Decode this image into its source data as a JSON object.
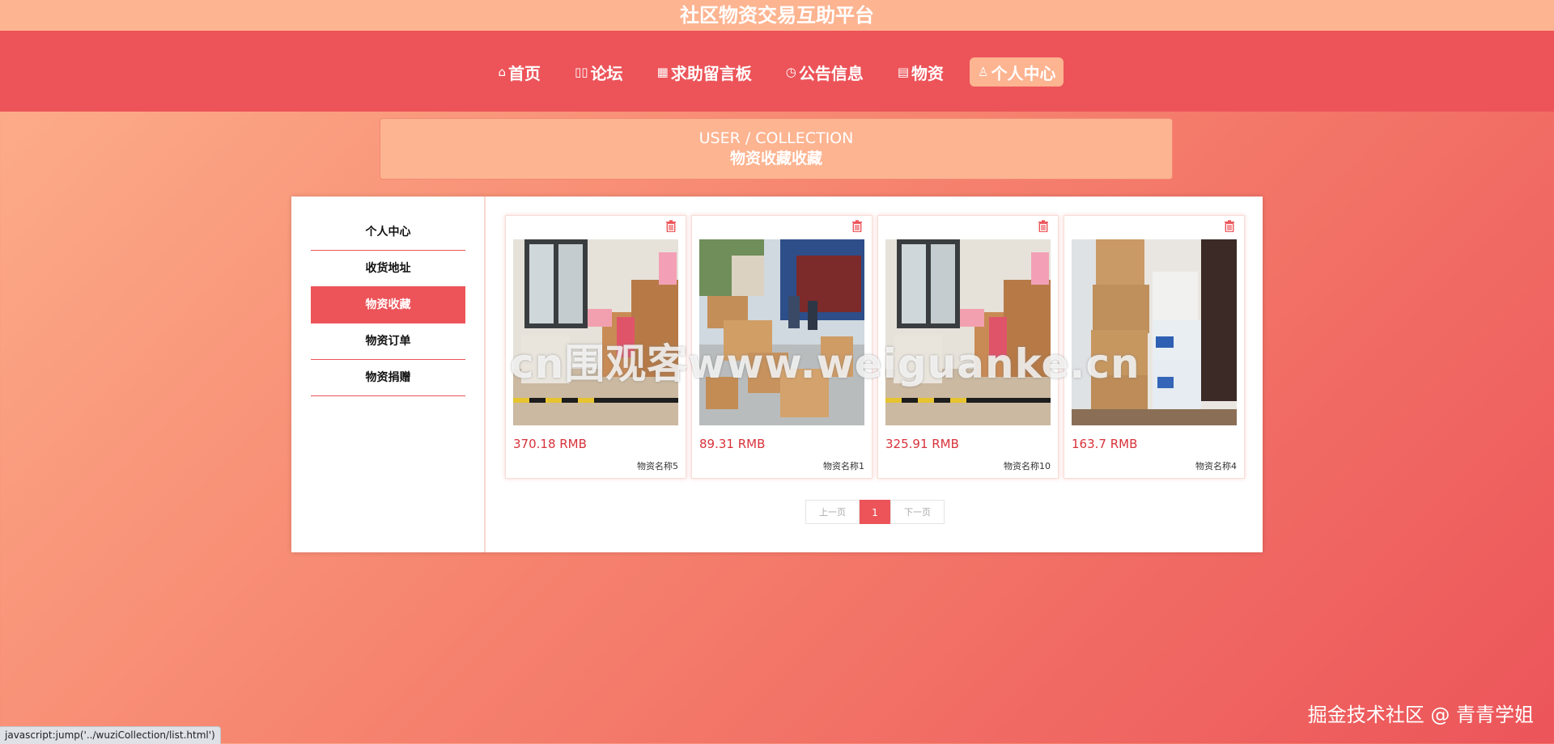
{
  "site": {
    "title": "社区物资交易互助平台"
  },
  "nav": {
    "items": [
      {
        "label": "首页",
        "icon": "home-icon",
        "glyph": "⌂"
      },
      {
        "label": "论坛",
        "icon": "book-icon",
        "glyph": "▯▯"
      },
      {
        "label": "求助留言板",
        "icon": "grid-icon",
        "glyph": "▦"
      },
      {
        "label": "公告信息",
        "icon": "clock-icon",
        "glyph": "◷"
      },
      {
        "label": "物资",
        "icon": "clipboard-icon",
        "glyph": "▤"
      },
      {
        "label": "个人中心",
        "icon": "user-icon",
        "glyph": "♙"
      }
    ],
    "active_index": 5,
    "active_color": "#fdb491",
    "bar_color": "#ec5459"
  },
  "banner": {
    "en": "USER / COLLECTION",
    "cn": "物资收藏收藏"
  },
  "sidebar": {
    "items": [
      {
        "label": "个人中心"
      },
      {
        "label": "收货地址"
      },
      {
        "label": "物资收藏"
      },
      {
        "label": "物资订单"
      },
      {
        "label": "物资捐赠"
      }
    ],
    "active_index": 2
  },
  "cards": [
    {
      "price": "370.18 RMB",
      "name": "物资名称5",
      "image": "storage-room-boxes"
    },
    {
      "price": "89.31 RMB",
      "name": "物资名称1",
      "image": "outdoor-boxes"
    },
    {
      "price": "325.91 RMB",
      "name": "物资名称10",
      "image": "storage-room-boxes"
    },
    {
      "price": "163.7 RMB",
      "name": "物资名称4",
      "image": "stacked-boxes"
    }
  ],
  "pagination": {
    "prev": "上一页",
    "current": "1",
    "next": "下一页"
  },
  "watermark": "cn围观客www.weiguanke.cn",
  "footer_mark": "掘金技术社区 @ 青青学姐",
  "status_bar": "javascript:jump('../wuziCollection/list.html')",
  "colors": {
    "accent": "#ec5459",
    "price": "#d8323a",
    "soft": "#fdb491"
  }
}
